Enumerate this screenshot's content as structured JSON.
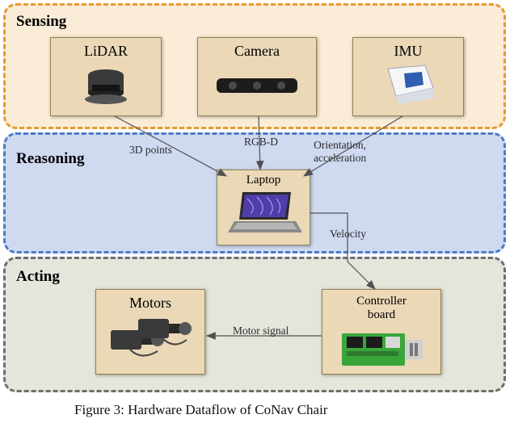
{
  "sections": {
    "sensing": {
      "label": "Sensing"
    },
    "reasoning": {
      "label": "Reasoning"
    },
    "acting": {
      "label": "Acting"
    }
  },
  "nodes": {
    "lidar": {
      "title": "LiDAR"
    },
    "camera": {
      "title": "Camera"
    },
    "imu": {
      "title": "IMU"
    },
    "laptop": {
      "title": "Laptop"
    },
    "motors": {
      "title": "Motors"
    },
    "controller": {
      "title": "Controller\nboard"
    }
  },
  "edges": {
    "lidar_laptop": {
      "label": "3D points"
    },
    "camera_laptop": {
      "label": "RGB-D"
    },
    "imu_laptop": {
      "label": "Orientation,\nacceleration"
    },
    "laptop_ctrl": {
      "label": "Velocity"
    },
    "ctrl_motors": {
      "label": "Motor signal"
    }
  },
  "caption": "Figure 3: Hardware Dataflow of CoNav Chair"
}
